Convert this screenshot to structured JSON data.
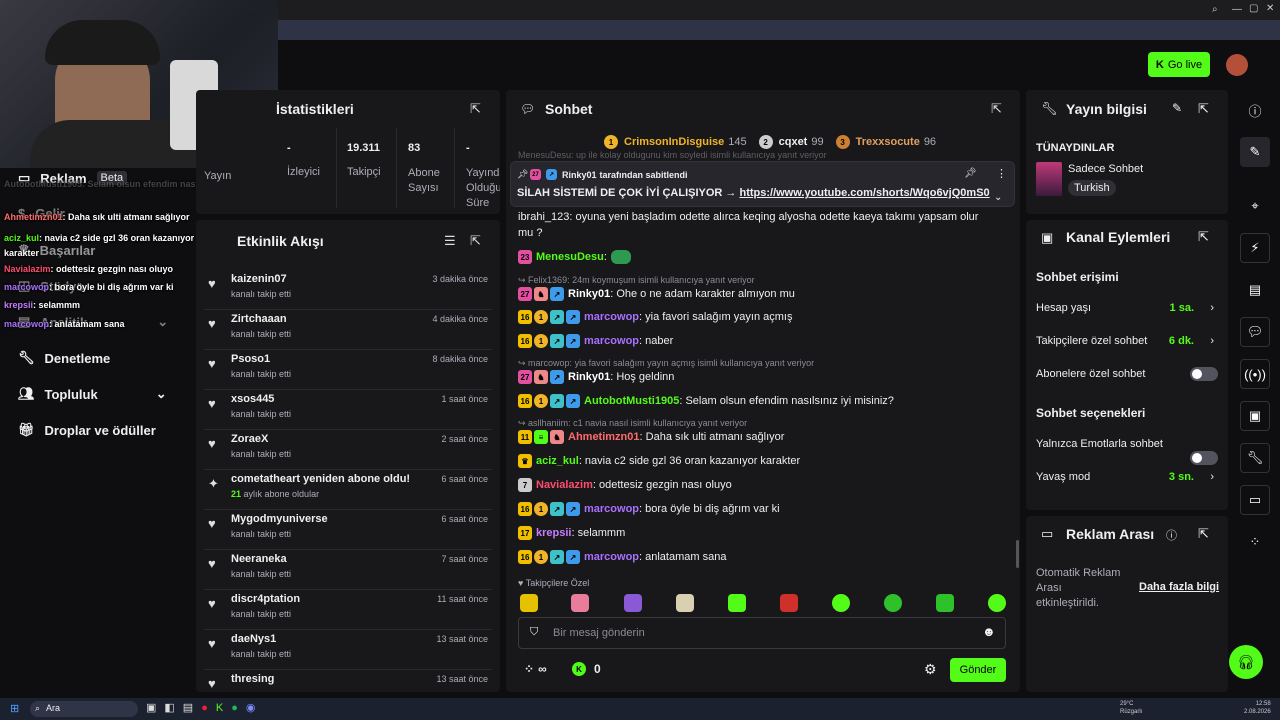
{
  "browser": {
    "icons": [
      "search",
      "window",
      "maximize",
      "close"
    ]
  },
  "header": {
    "go_live": "Go live"
  },
  "stats": {
    "title": "İstatistikleri",
    "cols": [
      {
        "value": "-",
        "label": "İzleyici"
      },
      {
        "value": "19.311",
        "label": "Takipçi"
      },
      {
        "value": "83",
        "label": "Abone Sayısı"
      },
      {
        "value": "-",
        "label": "Yayında Olduğu Süre"
      }
    ],
    "yayin": "Yayın"
  },
  "left_nav": {
    "reklam": "Reklam",
    "beta": "Beta",
    "gelir": "Gelir",
    "basarilar": "Başarılar",
    "studyo": "Stüdyo",
    "analitik": "Analitik",
    "denetleme": "Denetleme",
    "topluluk": "Topluluk",
    "droplar": "Droplar ve ödüller"
  },
  "overlay_chat": [
    {
      "user": "AutobotMusti1905",
      "text": ": Selam olsun efendim nasılsınız iyi misiniz?",
      "color": "#777"
    },
    {
      "user": "Ahmetimzn01",
      "text": ": Daha sık ulti atmanı sağlıyor",
      "color": "#ff6b6b"
    },
    {
      "user": "aciz_kul",
      "text": ": navia c2 side gzl 36 oran kazanıyor karakter",
      "color": "#53fc18"
    },
    {
      "user": "Navialazim",
      "text": ": odettesiz gezgin nası oluyo",
      "color": "#ff4d6d"
    },
    {
      "user": "marcowop",
      "text": ": bora öyle bi diş ağrım var ki",
      "color": "#a970ff"
    },
    {
      "user": "krepsii",
      "text": ": selammm",
      "color": "#c77dff"
    },
    {
      "user": "marcowop",
      "text": ": anlatamam sana",
      "color": "#a970ff"
    }
  ],
  "activity": {
    "title": "Etkinlik Akışı",
    "items": [
      {
        "name": "kaizenin07",
        "sub": "kanalı takip etti",
        "time": "3 dakika önce"
      },
      {
        "name": "Zirtchaaan",
        "sub": "kanalı takip etti",
        "time": "4 dakika önce"
      },
      {
        "name": "Psoso1",
        "sub": "kanalı takip etti",
        "time": "8 dakika önce"
      },
      {
        "name": "xsos445",
        "sub": "kanalı takip etti",
        "time": "1 saat önce"
      },
      {
        "name": "ZoraeX",
        "sub": "kanalı takip etti",
        "time": "2 saat önce"
      },
      {
        "name": "cometatheart yeniden abone oldu!",
        "sub_num": "21",
        "sub": " aylık abone oldular",
        "time": "6 saat önce"
      },
      {
        "name": "Mygodmyuniverse",
        "sub": "kanalı takip etti",
        "time": "6 saat önce"
      },
      {
        "name": "Neeraneka",
        "sub": "kanalı takip etti",
        "time": "7 saat önce"
      },
      {
        "name": "discr4ptation",
        "sub": "kanalı takip etti",
        "time": "11 saat önce"
      },
      {
        "name": "daeNys1",
        "sub": "kanalı takip etti",
        "time": "13 saat önce"
      },
      {
        "name": "thresing",
        "sub": "",
        "time": "13 saat önce"
      }
    ]
  },
  "chat": {
    "title": "Sohbet",
    "top": [
      {
        "name": "CrimsonInDisguise",
        "count": "145",
        "rank": "1"
      },
      {
        "name": "cqxet",
        "count": "99",
        "rank": "2"
      },
      {
        "name": "Trexxsocute",
        "count": "96",
        "rank": "3"
      }
    ],
    "pinned_by": "Rinky01",
    "pinned_suffix": " tarafından sabitlendi",
    "pinned_text": "SİLAH SİSTEMİ DE ÇOK İYİ ÇALIŞIYOR → ",
    "pinned_link": "https://www.youtube.com/shorts/Wqo6vjQ0mS0",
    "reply_hidden": "MenesuDesu: up ile kolay oldugunu kim soyledi isimli kullanıcıya yanıt veriyor",
    "partial1": "ibrahi_123: oyuna yeni başladım odette alırca keqing alyosha odette kaeya takımı yapsam olur",
    "partial2": "mu ?",
    "messages": [
      {
        "badge": "23",
        "user": "MenesuDesu",
        "text": ":",
        "color": "#53fc18"
      },
      {
        "reply": "Felix1369: 24m koymuşum isimli kullanıcıya yanıt veriyor"
      },
      {
        "badge": "27",
        "user": "Rinky01",
        "text": ": Ohe o ne adam karakter almıyon mu",
        "color": "#fff"
      },
      {
        "badge": "16",
        "user": "marcowop",
        "text": ": yia favori salağım yayın açmış",
        "color": "#a970ff"
      },
      {
        "badge": "16",
        "user": "marcowop",
        "text": ": naber",
        "color": "#a970ff"
      },
      {
        "reply": "marcowop: yia favori salağım yayın açmış isimli kullanıcıya yanıt veriyor"
      },
      {
        "badge": "27",
        "user": "Rinky01",
        "text": ": Hoş geldinn",
        "color": "#fff"
      },
      {
        "badge": "16",
        "user": "AutobotMusti1905",
        "text": ": Selam olsun efendim nasılsınız iyi misiniz?",
        "color": "#53fc18"
      },
      {
        "reply": "asllhaniim: c1 navia nasıl isimli kullanıcıya yanıt veriyor"
      },
      {
        "badge": "11",
        "user": "Ahmetimzn01",
        "text": ": Daha sık ulti atmanı sağlıyor",
        "color": "#ff6b6b"
      },
      {
        "badge": "crown",
        "user": "aciz_kul",
        "text": ": navia c2 side gzl 36 oran kazanıyor karakter",
        "color": "#53fc18"
      },
      {
        "badge": "7",
        "user": "Navialazim",
        "text": ": odettesiz gezgin nası oluyo",
        "color": "#ff4d6d"
      },
      {
        "badge": "16",
        "user": "marcowop",
        "text": ": bora öyle bi diş ağrım var ki",
        "color": "#a970ff"
      },
      {
        "badge": "17",
        "user": "krepsii",
        "text": ": selammm",
        "color": "#c77dff"
      },
      {
        "badge": "16",
        "user": "marcowop",
        "text": ": anlatamam sana",
        "color": "#a970ff"
      }
    ],
    "follower_only": "Takipçilere Özel",
    "placeholder": "Bir mesaj gönderin",
    "points": "∞",
    "count": "0",
    "send": "Gönder"
  },
  "stream_info": {
    "title": "Yayın bilgisi",
    "stream_title": "TÜNAYDINLAR",
    "category": "Sadece Sohbet",
    "language": "Turkish"
  },
  "channel_actions": {
    "title": "Kanal Eylemleri",
    "access": "Sohbet erişimi",
    "account_age": "Hesap yaşı",
    "account_age_val": "1 sa.",
    "followers_chat": "Takipçilere özel sohbet",
    "followers_chat_val": "6 dk.",
    "subs_chat": "Abonelere özel sohbet",
    "options": "Sohbet seçenekleri",
    "emote_only": "Yalnızca Emotlarla sohbet",
    "slow": "Yavaş mod",
    "slow_val": "3 sn."
  },
  "ad_break": {
    "title": "Reklam Arası",
    "text": "Otomatik Reklam Arası etkinleştirildi.",
    "link": "Daha fazla bilgi"
  },
  "taskbar": {
    "search": "Ara",
    "weather": "29°C",
    "weather2": "Rüzgarlı",
    "time": "12:58",
    "date": "2.08.2026"
  }
}
